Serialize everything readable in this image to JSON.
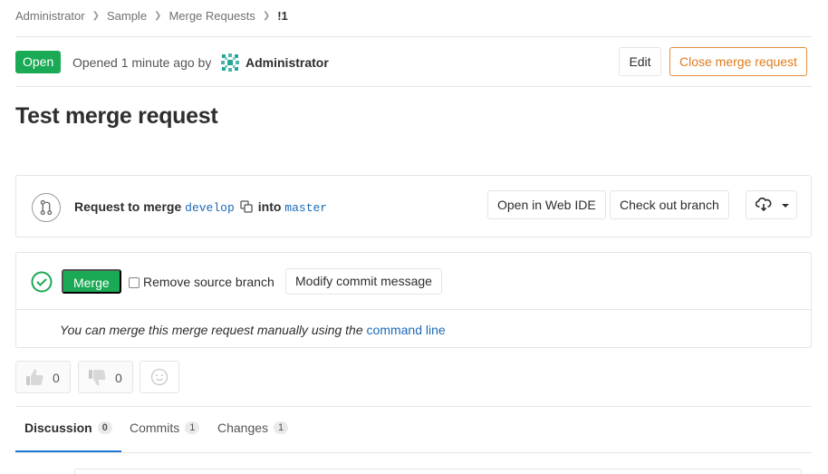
{
  "breadcrumb": {
    "items": [
      "Administrator",
      "Sample",
      "Merge Requests"
    ],
    "current": "!1"
  },
  "header": {
    "status_badge": "Open",
    "opened_text": "Opened 1 minute ago by",
    "author": "Administrator",
    "edit_label": "Edit",
    "close_label": "Close merge request"
  },
  "title": "Test merge request",
  "merge_info": {
    "prefix": "Request to merge",
    "source_branch": "develop",
    "into": "into",
    "target_branch": "master",
    "web_ide_label": "Open in Web IDE",
    "checkout_label": "Check out branch"
  },
  "merge_actions": {
    "merge_label": "Merge",
    "remove_source_label": "Remove source branch",
    "modify_commit_label": "Modify commit message",
    "manual_text": "You can merge this merge request manually using the",
    "command_line_link": "command line"
  },
  "awards": {
    "thumbs_up_count": "0",
    "thumbs_down_count": "0"
  },
  "tabs": [
    {
      "label": "Discussion",
      "count": "0"
    },
    {
      "label": "Commits",
      "count": "1"
    },
    {
      "label": "Changes",
      "count": "1"
    }
  ],
  "colors": {
    "success": "#1aaa55",
    "link": "#1b69b6",
    "warning": "#e07c1e",
    "active_tab": "#1f78d1"
  }
}
